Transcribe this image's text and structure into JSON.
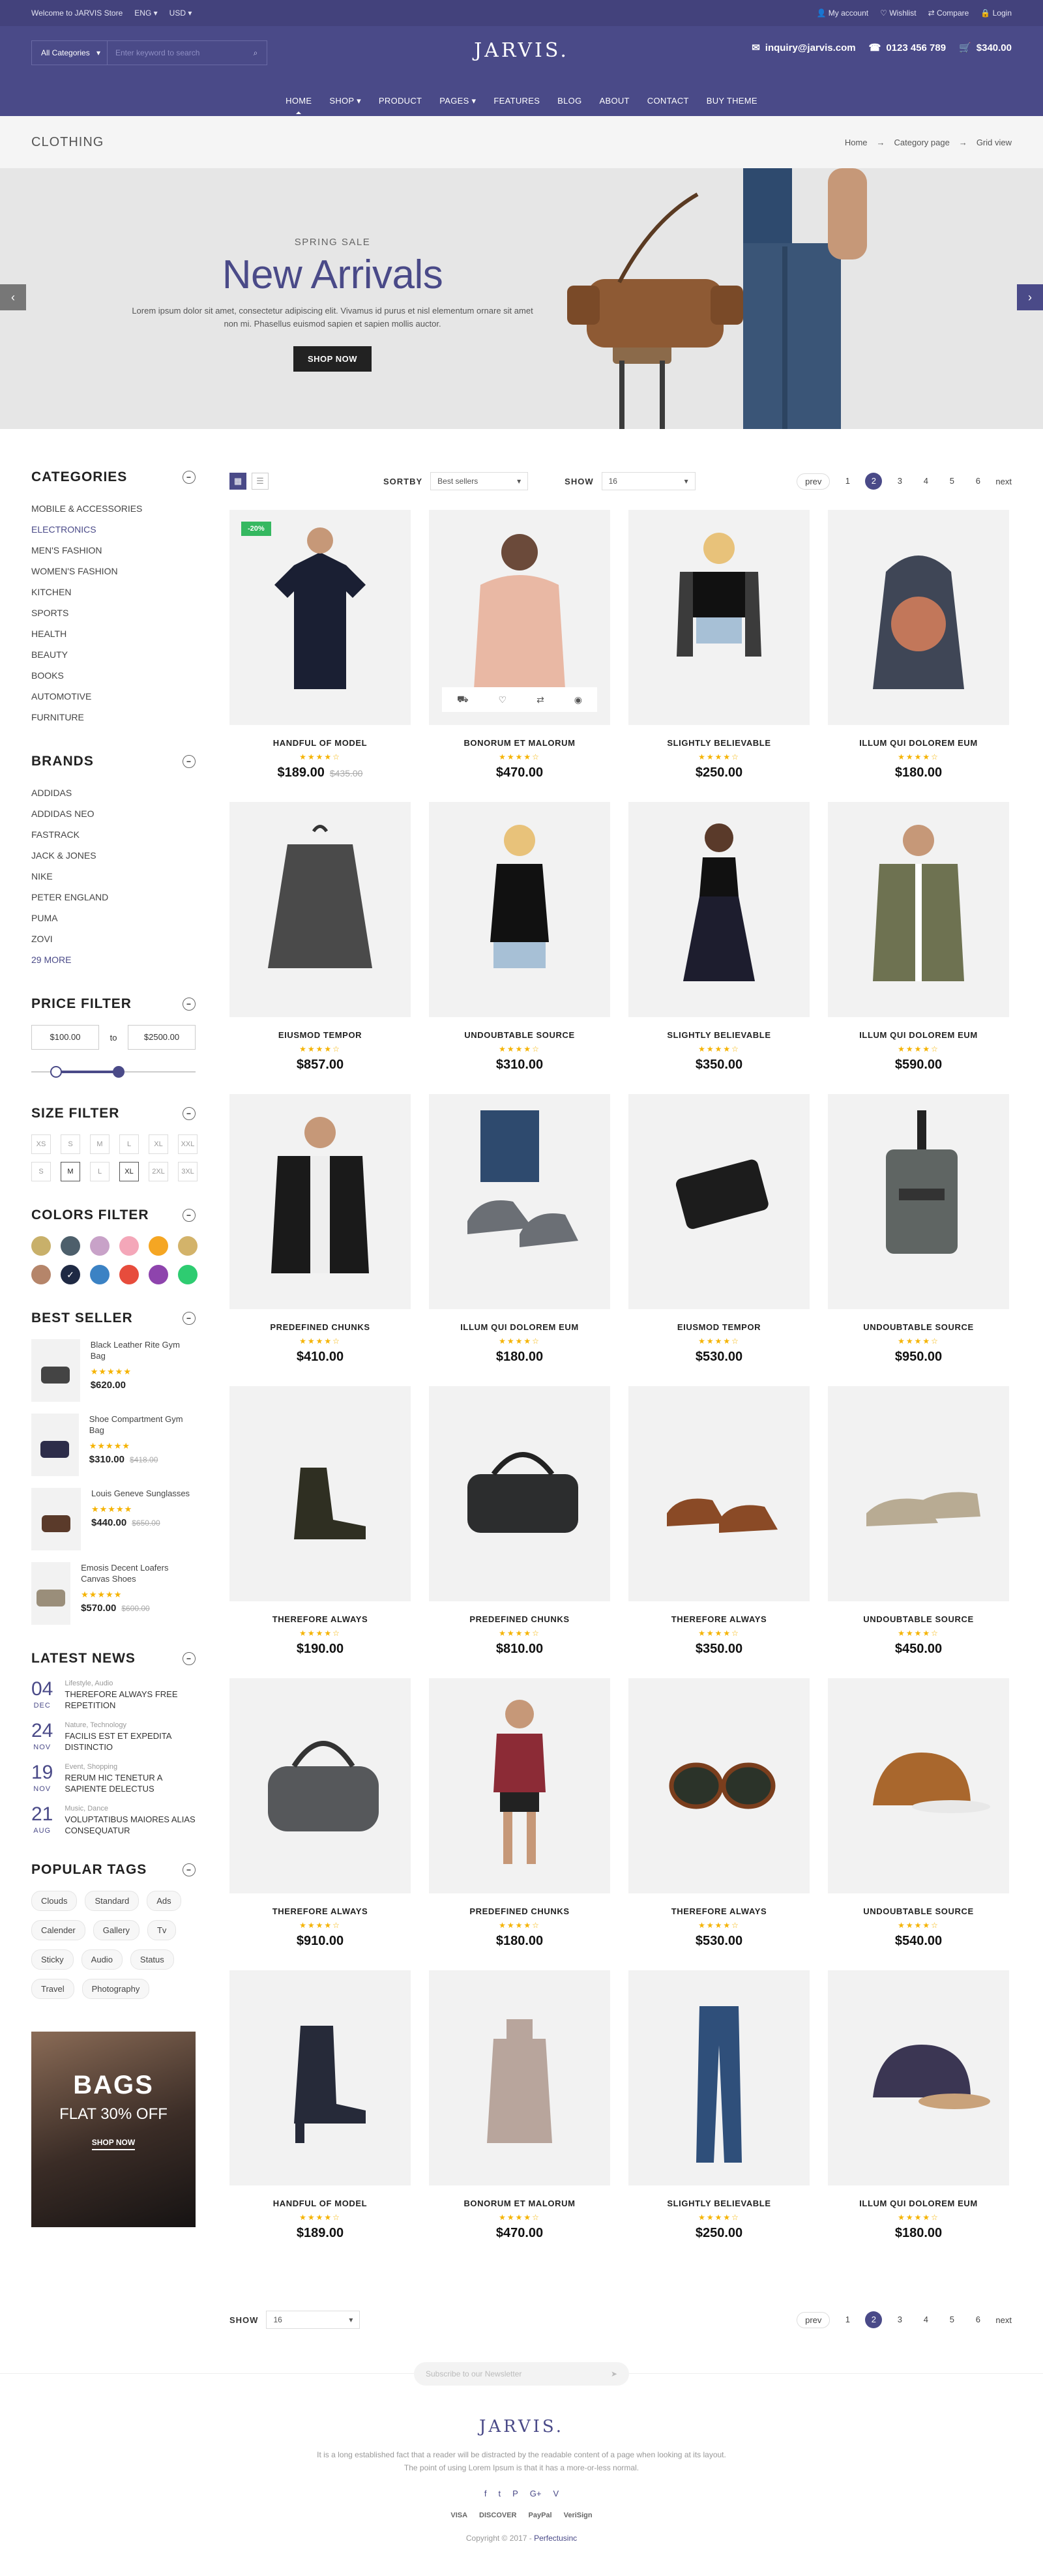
{
  "topbar": {
    "welcome": "Welcome to JARVIS Store",
    "lang": "ENG",
    "currency": "USD",
    "account": "My account",
    "wishlist": "Wishlist",
    "compare": "Compare",
    "login": "Login"
  },
  "header": {
    "category": "All Categories",
    "search_placeholder": "Enter keyword to search",
    "logo": "JARVIS.",
    "email": "inquiry@jarvis.com",
    "phone": "0123 456 789",
    "cart_total": "$340.00"
  },
  "nav": [
    "HOME",
    "SHOP",
    "PRODUCT",
    "PAGES",
    "FEATURES",
    "BLOG",
    "ABOUT",
    "CONTACT",
    "BUY THEME"
  ],
  "breadcrumb": {
    "title": "CLOTHING",
    "items": [
      "Home",
      "Category page",
      "Grid view"
    ]
  },
  "hero": {
    "eyebrow": "SPRING SALE",
    "title": "New Arrivals",
    "text": "Lorem ipsum dolor sit amet, consectetur adipiscing elit. Vivamus id purus et nisl elementum ornare sit amet non mi. Phasellus euismod sapien et sapien mollis auctor.",
    "button": "SHOP NOW"
  },
  "sidebar": {
    "categories": {
      "title": "CATEGORIES",
      "items": [
        "MOBILE & ACCESSORIES",
        "ELECTRONICS",
        "MEN'S FASHION",
        "WOMEN'S FASHION",
        "KITCHEN",
        "SPORTS",
        "HEALTH",
        "BEAUTY",
        "BOOKS",
        "AUTOMOTIVE",
        "FURNITURE"
      ]
    },
    "brands": {
      "title": "BRANDS",
      "items": [
        "ADDIDAS",
        "ADDIDAS NEO",
        "FASTRACK",
        "JACK & JONES",
        "NIKE",
        "PETER ENGLAND",
        "PUMA",
        "ZOVI",
        "29 MORE"
      ]
    },
    "price": {
      "title": "PRICE FILTER",
      "min": "$100.00",
      "to": "to",
      "max": "$2500.00",
      "range_low": 0.15,
      "range_high": 0.53
    },
    "size": {
      "title": "SIZE FILTER",
      "items": [
        "XS",
        "S",
        "M",
        "L",
        "XL",
        "XXL",
        "S",
        "M",
        "L",
        "XL",
        "2XL",
        "3XL"
      ],
      "active": [
        7,
        9
      ]
    },
    "colors": {
      "title": "COLORS FILTER",
      "items": [
        "#c8b06a",
        "#4d5f6b",
        "#c8a2c8",
        "#f4a7b9",
        "#f5a623",
        "#d3b36a",
        "#b5856a",
        "#1f2a44",
        "#3b82c4",
        "#e74c3c",
        "#8e44ad",
        "#2ecc71"
      ],
      "selected": 7
    },
    "best": {
      "title": "BEST SELLER",
      "items": [
        {
          "name": "Black Leather Rite Gym Bag",
          "price": "$620.00",
          "old": "",
          "stars": "★★★★★"
        },
        {
          "name": "Shoe Compartment Gym Bag",
          "price": "$310.00",
          "old": "$418.00",
          "stars": "★★★★★"
        },
        {
          "name": "Louis Geneve Sunglasses",
          "price": "$440.00",
          "old": "$650.00",
          "stars": "★★★★★"
        },
        {
          "name": "Emosis Decent Loafers Canvas Shoes",
          "price": "$570.00",
          "old": "$600.00",
          "stars": "★★★★★"
        }
      ]
    },
    "news": {
      "title": "LATEST NEWS",
      "items": [
        {
          "day": "04",
          "mon": "DEC",
          "cat": "Lifestyle, Audio",
          "title": "THEREFORE ALWAYS FREE REPETITION"
        },
        {
          "day": "24",
          "mon": "NOV",
          "cat": "Nature, Technology",
          "title": "FACILIS EST ET EXPEDITA DISTINCTIO"
        },
        {
          "day": "19",
          "mon": "NOV",
          "cat": "Event, Shopping",
          "title": "RERUM HIC TENETUR A SAPIENTE DELECTUS"
        },
        {
          "day": "21",
          "mon": "AUG",
          "cat": "Music, Dance",
          "title": "VOLUPTATIBUS MAIORES ALIAS CONSEQUATUR"
        }
      ]
    },
    "tags": {
      "title": "POPULAR TAGS",
      "items": [
        "Clouds",
        "Standard",
        "Ads",
        "Calender",
        "Gallery",
        "Tv",
        "Sticky",
        "Audio",
        "Status",
        "Travel",
        "Photography"
      ]
    },
    "banner": {
      "title": "BAGS",
      "sub": "FLAT 30% OFF",
      "cta": "SHOP NOW"
    }
  },
  "toolbar": {
    "sortby": "SORTBY",
    "sort_value": "Best sellers",
    "show": "SHOW",
    "show_value": "16",
    "prev": "prev",
    "pages": [
      "1",
      "2",
      "3",
      "4",
      "5",
      "6"
    ],
    "active_page": "2",
    "next": "next"
  },
  "products": [
    {
      "name": "HANDFUL OF MODEL",
      "price": "$189.00",
      "old": "$435.00",
      "badge": "-20%",
      "icon": "tshirt",
      "color": "#1a1f33"
    },
    {
      "name": "BONORUM ET MALORUM",
      "price": "$470.00",
      "old": "",
      "badge": "",
      "icon": "sweater",
      "color": "#e9b8a4"
    },
    {
      "name": "SLIGHTLY BELIEVABLE",
      "price": "$250.00",
      "old": "",
      "badge": "",
      "icon": "flannel",
      "color": "#3b3b3b"
    },
    {
      "name": "ILLUM QUI DOLOREM EUM",
      "price": "$180.00",
      "old": "",
      "badge": "",
      "icon": "hoodie",
      "color": "#3f4656"
    },
    {
      "name": "EIUSMOD TEMPOR",
      "price": "$857.00",
      "old": "",
      "badge": "",
      "icon": "scarf",
      "color": "#4a4a4a"
    },
    {
      "name": "UNDOUBTABLE SOURCE",
      "price": "$310.00",
      "old": "",
      "badge": "",
      "icon": "tank",
      "color": "#111111"
    },
    {
      "name": "SLIGHTLY BELIEVABLE",
      "price": "$350.00",
      "old": "",
      "badge": "",
      "icon": "dress",
      "color": "#1d1d2e"
    },
    {
      "name": "ILLUM QUI DOLOREM EUM",
      "price": "$590.00",
      "old": "",
      "badge": "",
      "icon": "jacket",
      "color": "#6e7251"
    },
    {
      "name": "PREDEFINED CHUNKS",
      "price": "$410.00",
      "old": "",
      "badge": "",
      "icon": "leather",
      "color": "#1a1a1a"
    },
    {
      "name": "ILLUM QUI DOLOREM EUM",
      "price": "$180.00",
      "old": "",
      "badge": "",
      "icon": "sneaker",
      "color": "#6b6f75"
    },
    {
      "name": "EIUSMOD TEMPOR",
      "price": "$530.00",
      "old": "",
      "badge": "",
      "icon": "wallet",
      "color": "#1c1c1c"
    },
    {
      "name": "UNDOUBTABLE SOURCE",
      "price": "$950.00",
      "old": "",
      "badge": "",
      "icon": "crossbag",
      "color": "#5f6563"
    },
    {
      "name": "THEREFORE ALWAYS",
      "price": "$190.00",
      "old": "",
      "badge": "",
      "icon": "boot",
      "color": "#2f2f22"
    },
    {
      "name": "PREDEFINED CHUNKS",
      "price": "$810.00",
      "old": "",
      "badge": "",
      "icon": "duffel",
      "color": "#2c2d2e"
    },
    {
      "name": "THEREFORE ALWAYS",
      "price": "$350.00",
      "old": "",
      "badge": "",
      "icon": "brogue",
      "color": "#8a4a26"
    },
    {
      "name": "UNDOUBTABLE SOURCE",
      "price": "$450.00",
      "old": "",
      "badge": "",
      "icon": "loafer",
      "color": "#b8ab93"
    },
    {
      "name": "THEREFORE ALWAYS",
      "price": "$910.00",
      "old": "",
      "badge": "",
      "icon": "duffel2",
      "color": "#56585b"
    },
    {
      "name": "PREDEFINED CHUNKS",
      "price": "$180.00",
      "old": "",
      "badge": "",
      "icon": "outfit",
      "color": "#8c2b36"
    },
    {
      "name": "THEREFORE ALWAYS",
      "price": "$530.00",
      "old": "",
      "badge": "",
      "icon": "sunglasses",
      "color": "#7a3e1d"
    },
    {
      "name": "UNDOUBTABLE SOURCE",
      "price": "$540.00",
      "old": "",
      "badge": "",
      "icon": "cap",
      "color": "#a9672d"
    },
    {
      "name": "HANDFUL OF MODEL",
      "price": "$189.00",
      "old": "",
      "badge": "",
      "icon": "heel",
      "color": "#262a39"
    },
    {
      "name": "BONORUM ET MALORUM",
      "price": "$470.00",
      "old": "",
      "badge": "",
      "icon": "turtleneck",
      "color": "#b8a59c"
    },
    {
      "name": "SLIGHTLY BELIEVABLE",
      "price": "$250.00",
      "old": "",
      "badge": "",
      "icon": "jeans",
      "color": "#2f4f7a"
    },
    {
      "name": "ILLUM QUI DOLOREM EUM",
      "price": "$180.00",
      "old": "",
      "badge": "",
      "icon": "cap2",
      "color": "#3b3653"
    }
  ],
  "rating": "★★★★☆",
  "card_actions": [
    "cart-icon",
    "heart-icon",
    "compare-icon",
    "eye-icon"
  ],
  "footer": {
    "newsletter": "Subscribe to our Newsletter",
    "logo": "JARVIS.",
    "desc": "It is a long established fact that a reader will be distracted by the readable content of a page when looking at its layout. The point of using Lorem Ipsum is that it has a more-or-less normal.",
    "social": [
      "f",
      "t",
      "P",
      "G+",
      "V"
    ],
    "payments": [
      "VISA",
      "DISCOVER",
      "PayPal",
      "VeriSign"
    ],
    "copyright": "Copyright © 2017 -",
    "brand": "Perfectusinc"
  }
}
